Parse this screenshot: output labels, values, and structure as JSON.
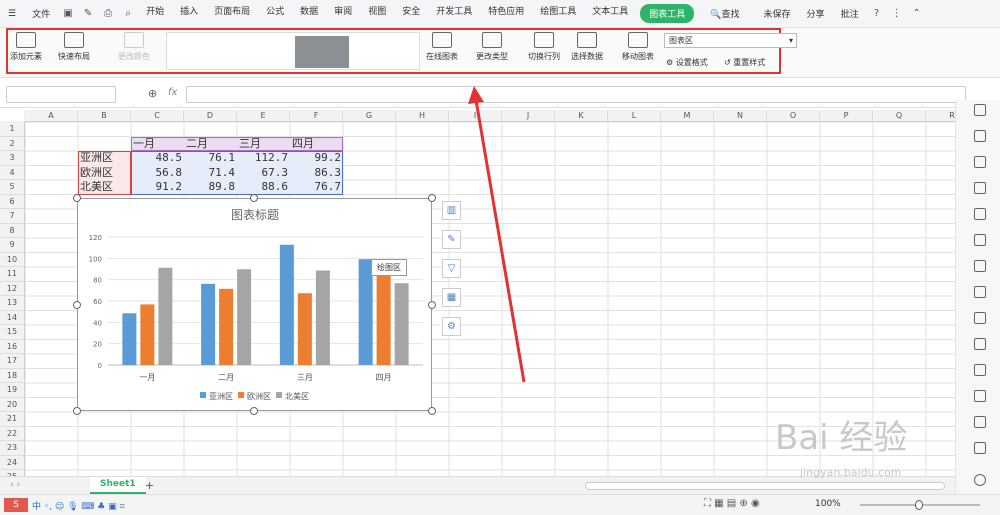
{
  "menubar": {
    "file": "文件",
    "tabs": [
      "开始",
      "插入",
      "页面布局",
      "公式",
      "数据",
      "审阅",
      "视图",
      "安全",
      "开发工具",
      "特色应用",
      "绘图工具",
      "文本工具",
      "图表工具"
    ],
    "search": "查找",
    "unsaved": "未保存",
    "share": "分享",
    "comment": "批注"
  },
  "ribbon": {
    "add_element": "添加元素",
    "quick_layout": "快速布局",
    "change_color": "更改颜色",
    "online_chart": "在线图表",
    "change_type": "更改类型",
    "switch_rowcol": "切换行列",
    "select_data": "选择数据",
    "move_chart": "移动图表",
    "area_select": "图表区",
    "format": "设置格式",
    "reset": "重置样式"
  },
  "formula": {
    "fx": "fx"
  },
  "columns": [
    "A",
    "B",
    "C",
    "D",
    "E",
    "F",
    "G",
    "H",
    "I",
    "J",
    "K",
    "L",
    "M",
    "N",
    "O",
    "P",
    "Q",
    "R"
  ],
  "rows": [
    "1",
    "2",
    "3",
    "4",
    "5",
    "6",
    "7",
    "8",
    "9",
    "10",
    "11",
    "12",
    "13",
    "14",
    "15",
    "16",
    "17",
    "18",
    "19",
    "20",
    "21",
    "22",
    "23",
    "24",
    "25"
  ],
  "table": {
    "headers": [
      "一月",
      "二月",
      "三月",
      "四月"
    ],
    "row_labels": [
      "亚洲区",
      "欧洲区",
      "北美区"
    ],
    "values": [
      [
        "48.5",
        "76.1",
        "112.7",
        "99.2"
      ],
      [
        "56.8",
        "71.4",
        "67.3",
        "86.3"
      ],
      [
        "91.2",
        "89.8",
        "88.6",
        "76.7"
      ]
    ]
  },
  "chart_data": {
    "type": "bar",
    "title": "图表标题",
    "categories": [
      "一月",
      "二月",
      "三月",
      "四月"
    ],
    "series": [
      {
        "name": "亚洲区",
        "values": [
          48.5,
          76.1,
          112.7,
          99.2
        ],
        "color": "#5b9bd5"
      },
      {
        "name": "欧洲区",
        "values": [
          56.8,
          71.4,
          67.3,
          86.3
        ],
        "color": "#ed7d31"
      },
      {
        "name": "北美区",
        "values": [
          91.2,
          89.8,
          88.6,
          76.7
        ],
        "color": "#a5a5a5"
      }
    ],
    "ylim": [
      0,
      120
    ],
    "yticks": [
      "0",
      "20",
      "40",
      "60",
      "80",
      "100",
      "120"
    ],
    "legend": "bottom",
    "grid": true
  },
  "tooltip": "绘图区",
  "sheet": {
    "tab": "Sheet1",
    "add": "+"
  },
  "status": {
    "zoom": "100%"
  },
  "watermark": {
    "text": "Bai 经验",
    "url": "jingyan.baidu.com"
  }
}
